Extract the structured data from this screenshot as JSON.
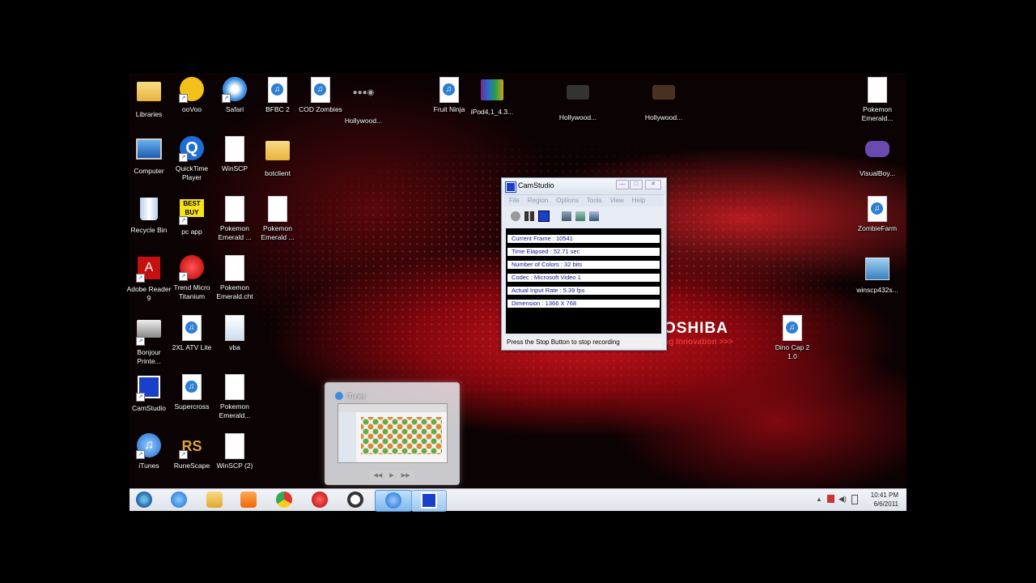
{
  "desktop": {
    "brand": "OSHIBA",
    "tagline": "ng Innovation >>>",
    "icons": [
      {
        "label": "Libraries",
        "icon": "libraries-folder-icon"
      },
      {
        "label": "ooVoo",
        "icon": "oovoo-icon"
      },
      {
        "label": "Safari",
        "icon": "safari-compass-icon"
      },
      {
        "label": "BFBC 2",
        "icon": "ipa-file-icon"
      },
      {
        "label": "COD Zombies",
        "icon": "ipa-file-icon"
      },
      {
        "label": "Hollywood...",
        "icon": "hollywood-app-icon"
      },
      {
        "label": "Fruit Ninja",
        "icon": "ipa-file-icon"
      },
      {
        "label": "iPod4,1_4.3...",
        "icon": "winrar-archive-icon"
      },
      {
        "label": "Hollywood...",
        "icon": "hollywood-app-icon"
      },
      {
        "label": "Hollywood...",
        "icon": "hollywood-app-icon"
      },
      {
        "label": "Pokemon Emerald...",
        "icon": "document-icon"
      },
      {
        "label": "Computer",
        "icon": "computer-icon"
      },
      {
        "label": "QuickTime Player",
        "icon": "quicktime-icon"
      },
      {
        "label": "WinSCP",
        "icon": "document-icon"
      },
      {
        "label": "botclient",
        "icon": "folder-icon"
      },
      {
        "label": "VisualBoy...",
        "icon": "gameboy-icon"
      },
      {
        "label": "Recycle Bin",
        "icon": "recycle-bin-icon"
      },
      {
        "label": "pc app",
        "icon": "bestbuy-icon"
      },
      {
        "label": "Pokemon Emerald ...",
        "icon": "document-icon"
      },
      {
        "label": "Pokemon Emerald ...",
        "icon": "document-icon"
      },
      {
        "label": "ZombieFarm",
        "icon": "ipa-file-icon"
      },
      {
        "label": "Adobe Reader 9",
        "icon": "adobe-reader-icon"
      },
      {
        "label": "Trend Micro Titanium",
        "icon": "trend-micro-icon"
      },
      {
        "label": "Pokemon Emerald.cht",
        "icon": "document-icon"
      },
      {
        "label": "winscp432s...",
        "icon": "installer-icon"
      },
      {
        "label": "Bonjour Printe...",
        "icon": "printer-icon"
      },
      {
        "label": "2XL ATV Lite",
        "icon": "ipa-file-icon"
      },
      {
        "label": "vba",
        "icon": "settings-file-icon"
      },
      {
        "label": "Dino Cap 2 1.0",
        "icon": "ipa-file-icon"
      },
      {
        "label": "CamStudio",
        "icon": "camstudio-icon"
      },
      {
        "label": "Supercross",
        "icon": "ipa-file-icon"
      },
      {
        "label": "Pokemon Emerald...",
        "icon": "document-icon"
      },
      {
        "label": "iTunes",
        "icon": "itunes-icon"
      },
      {
        "label": "RuneScape",
        "icon": "runescape-icon"
      },
      {
        "label": "WinSCP (2)",
        "icon": "document-icon"
      }
    ]
  },
  "camstudio": {
    "title": "CamStudio",
    "menu": [
      "File",
      "Region",
      "Options",
      "Tools",
      "View",
      "Help"
    ],
    "stats": [
      "Current Frame : 10541",
      "Time Elapsed : 52.71 sec",
      "Number of Colors : 32 bits",
      "Codec : Microsoft Video 1",
      "Actual Input Rate : 5.39 fps",
      "Dimension : 1366 X 768"
    ],
    "status": "Press the Stop Button to stop recording"
  },
  "itunes_preview": {
    "title": "iTunes"
  },
  "taskbar": {
    "time": "10:41 PM",
    "date": "6/6/2011"
  },
  "colors": {
    "taskbar": "#dfe3ea",
    "cam_text": "#101890",
    "wallpaper_red": "#c8141e"
  }
}
